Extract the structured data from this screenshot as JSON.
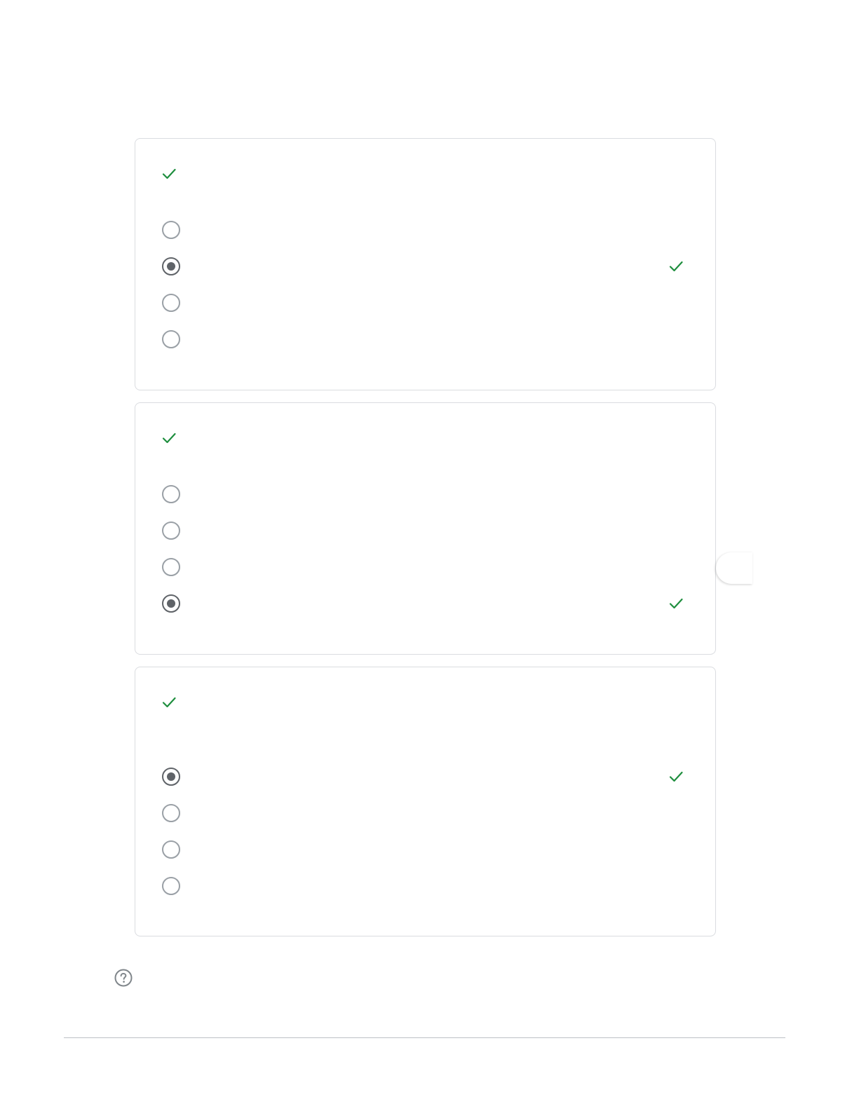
{
  "colors": {
    "correct_check": "#1e8e3e",
    "radio_unchecked": "#9aa0a6",
    "radio_checked": "#5f6368",
    "card_border": "#dadce0"
  },
  "icons": {
    "question_status": "check-icon",
    "option_correct": "check-icon",
    "help": "help-circle-icon"
  },
  "questions": [
    {
      "title": "",
      "status": "correct",
      "options": [
        {
          "label": "",
          "selected": false,
          "correct_mark": false
        },
        {
          "label": "",
          "selected": true,
          "correct_mark": true
        },
        {
          "label": "",
          "selected": false,
          "correct_mark": false
        },
        {
          "label": "",
          "selected": false,
          "correct_mark": false
        }
      ]
    },
    {
      "title": "",
      "status": "correct",
      "options": [
        {
          "label": "",
          "selected": false,
          "correct_mark": false
        },
        {
          "label": "",
          "selected": false,
          "correct_mark": false
        },
        {
          "label": "",
          "selected": false,
          "correct_mark": false
        },
        {
          "label": "",
          "selected": true,
          "correct_mark": true
        }
      ]
    },
    {
      "title": "",
      "status": "correct",
      "options": [
        {
          "label": "",
          "selected": true,
          "correct_mark": true
        },
        {
          "label": "",
          "selected": false,
          "correct_mark": false
        },
        {
          "label": "",
          "selected": false,
          "correct_mark": false
        },
        {
          "label": "",
          "selected": false,
          "correct_mark": false
        }
      ]
    }
  ]
}
